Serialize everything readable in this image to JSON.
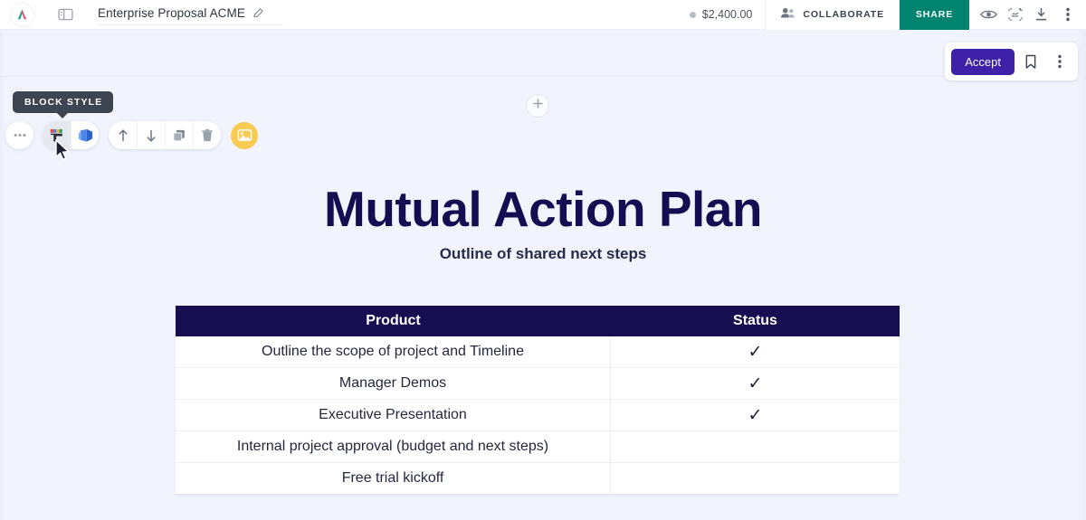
{
  "header": {
    "logo_icon": "app-logo-icon",
    "panel_toggle_icon": "side-panel-icon",
    "document_title": "Enterprise Proposal ACME",
    "edit_icon": "pencil-icon",
    "price": "$2,400.00",
    "collaborate_label": "COLLABORATE",
    "collaborate_icon": "people-icon",
    "share_label": "SHARE",
    "share_color": "#00836f",
    "icons": [
      {
        "name": "eye-icon"
      },
      {
        "name": "signature-icon"
      },
      {
        "name": "download-icon"
      },
      {
        "name": "more-vertical-icon"
      }
    ]
  },
  "accept_panel": {
    "accept_label": "Accept",
    "accept_color": "#3d21a8",
    "bookmark_icon": "bookmark-icon",
    "more_icon": "more-vertical-icon"
  },
  "block_toolbar": {
    "tooltip": "BLOCK STYLE",
    "more_icon": "ellipsis-icon",
    "style_icon": "paint-roller-icon",
    "layout_icon": "layers-icon",
    "move_up_icon": "arrow-up-icon",
    "move_down_icon": "arrow-down-icon",
    "duplicate_icon": "duplicate-icon",
    "delete_icon": "trash-icon",
    "image_icon": "image-icon",
    "image_button_color": "#f8cb53"
  },
  "add_block": {
    "icon": "plus-icon",
    "label": "+"
  },
  "document": {
    "title": "Mutual Action Plan",
    "title_color": "#140d52",
    "subtitle": "Outline of shared next steps",
    "table": {
      "header_color": "#170e52",
      "columns": [
        "Product",
        "Status"
      ],
      "rows": [
        {
          "product": "Outline the scope of project and Timeline",
          "status": "✓"
        },
        {
          "product": "Manager Demos",
          "status": "✓"
        },
        {
          "product": "Executive Presentation",
          "status": "✓"
        },
        {
          "product": "Internal project approval (budget and next steps)",
          "status": ""
        },
        {
          "product": "Free trial kickoff",
          "status": ""
        }
      ]
    }
  }
}
